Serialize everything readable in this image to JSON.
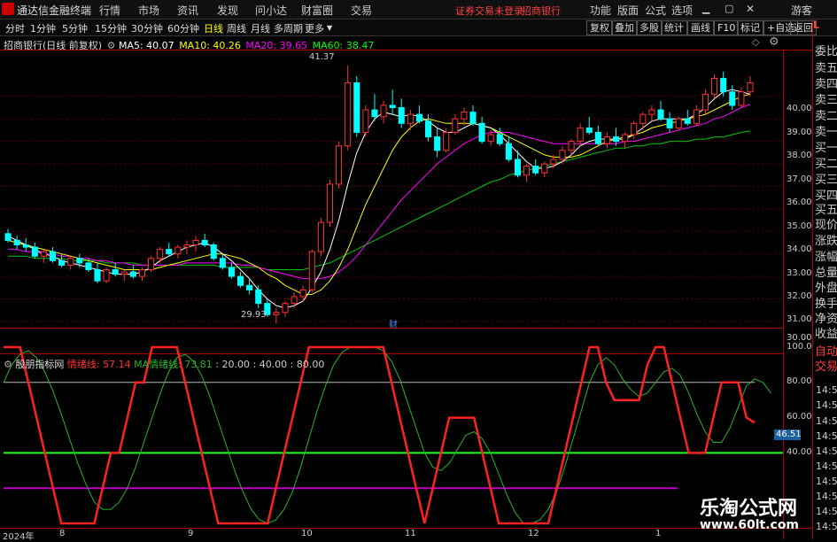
{
  "app": {
    "title": "通达信金融终端",
    "login_status": "证券交易未登录",
    "stock_short": "招商银行",
    "guest": "游客"
  },
  "menu": [
    "行情",
    "市场",
    "资讯",
    "发现",
    "问小达",
    "财富圈",
    "交易"
  ],
  "menu_right": [
    "功能",
    "版面",
    "公式",
    "选项"
  ],
  "periods": [
    "分时",
    "1分钟",
    "5分钟",
    "15分钟",
    "30分钟",
    "60分钟",
    "日线",
    "周线",
    "月线",
    "多周期",
    "更多"
  ],
  "active_period": "日线",
  "toolbar_right": [
    "复权",
    "叠加",
    "多股",
    "统计",
    "画线",
    "F10",
    "标记",
    "+自选",
    "返回"
  ],
  "chart_title": "招商银行(日线 前复权)",
  "ma": [
    {
      "label": "MA5: 40.07",
      "color": "#ffffff"
    },
    {
      "label": "MA10: 40.26",
      "color": "#ffff00"
    },
    {
      "label": "MA20: 39.65",
      "color": "#ff00ff"
    },
    {
      "label": "MA60: 38.47",
      "color": "#00ff00"
    }
  ],
  "max_label": "41.37",
  "min_label": "29.93",
  "cai_label": "财",
  "price_ticks": [
    "40.00",
    "39.00",
    "38.00",
    "37.00",
    "36.00",
    "35.00",
    "34.00",
    "33.00",
    "32.00",
    "31.00",
    "30.00"
  ],
  "right_panel": [
    "委比",
    "卖五",
    "卖四",
    "卖三",
    "卖二",
    "卖一",
    "买一",
    "买二",
    "买三",
    "买四",
    "买五",
    "现价",
    "涨跌",
    "涨幅",
    "总量",
    "外盘",
    "换手",
    "净资",
    "收益"
  ],
  "right_panel_small": "L",
  "indicator": {
    "name": "殷朋指标网",
    "line1": "情绪线: 57.14",
    "line2": "MA情绪线: 73.81",
    "levels": ": 20.00 : 40.00 : 80.00",
    "ticks": [
      "100.0",
      "80.00",
      "60.00",
      "40.00"
    ],
    "current": "46.51",
    "right_labels": [
      "自动",
      "交易"
    ],
    "time_ticks": [
      "14:56",
      "14:56",
      "14:56",
      "14:56",
      "14:56",
      "14:56",
      "14:56",
      "14:56",
      "14:56",
      "14:56"
    ]
  },
  "dates": [
    "2024年",
    "8",
    "9",
    "10",
    "11",
    "12",
    "1"
  ],
  "watermark": {
    "line1": "乐淘公式网",
    "line2": "www.60lt.com"
  },
  "chart_data": {
    "type": "candlestick",
    "ylim": [
      29.8,
      42.0
    ],
    "candles": [
      [
        33.9,
        34.1,
        33.5,
        33.6
      ],
      [
        33.6,
        33.8,
        33.2,
        33.4
      ],
      [
        33.4,
        33.7,
        33.1,
        33.3
      ],
      [
        33.3,
        33.5,
        32.8,
        32.9
      ],
      [
        32.9,
        33.2,
        32.6,
        33.1
      ],
      [
        33.1,
        33.3,
        32.6,
        32.7
      ],
      [
        32.7,
        33.0,
        32.4,
        32.5
      ],
      [
        32.5,
        32.9,
        32.3,
        32.8
      ],
      [
        32.8,
        33.0,
        32.4,
        32.6
      ],
      [
        32.6,
        32.8,
        32.2,
        32.3
      ],
      [
        32.3,
        32.6,
        31.7,
        31.8
      ],
      [
        31.8,
        32.4,
        31.7,
        32.3
      ],
      [
        32.3,
        32.6,
        32.0,
        32.1
      ],
      [
        32.1,
        32.3,
        31.8,
        32.2
      ],
      [
        32.2,
        32.5,
        31.9,
        32.0
      ],
      [
        32.0,
        32.4,
        31.8,
        32.3
      ],
      [
        32.3,
        32.9,
        32.2,
        32.8
      ],
      [
        32.8,
        33.3,
        32.6,
        33.2
      ],
      [
        33.2,
        33.5,
        32.9,
        33.0
      ],
      [
        33.0,
        33.4,
        32.8,
        33.3
      ],
      [
        33.3,
        33.6,
        33.0,
        33.4
      ],
      [
        33.4,
        33.8,
        33.1,
        33.6
      ],
      [
        33.6,
        33.9,
        33.3,
        33.4
      ],
      [
        33.4,
        33.5,
        32.7,
        32.8
      ],
      [
        32.8,
        33.0,
        32.3,
        32.4
      ],
      [
        32.4,
        32.6,
        31.9,
        32.0
      ],
      [
        32.0,
        32.2,
        31.5,
        31.6
      ],
      [
        31.6,
        31.9,
        31.2,
        31.4
      ],
      [
        31.4,
        31.6,
        30.6,
        30.8
      ],
      [
        30.8,
        31.0,
        30.2,
        30.3
      ],
      [
        30.3,
        30.6,
        29.9,
        30.4
      ],
      [
        30.4,
        30.9,
        30.2,
        30.8
      ],
      [
        30.8,
        31.3,
        30.6,
        31.1
      ],
      [
        31.1,
        31.6,
        30.9,
        31.4
      ],
      [
        31.4,
        33.2,
        31.3,
        33.1
      ],
      [
        33.1,
        34.6,
        32.9,
        34.4
      ],
      [
        34.4,
        36.3,
        34.2,
        36.1
      ],
      [
        36.1,
        38.0,
        35.9,
        37.8
      ],
      [
        37.8,
        41.37,
        37.6,
        40.6
      ],
      [
        40.6,
        40.9,
        38.2,
        38.4
      ],
      [
        38.4,
        39.6,
        38.2,
        39.4
      ],
      [
        39.4,
        40.1,
        38.9,
        39.1
      ],
      [
        39.1,
        39.8,
        38.8,
        39.6
      ],
      [
        39.6,
        40.3,
        39.2,
        39.5
      ],
      [
        39.5,
        39.9,
        38.6,
        38.8
      ],
      [
        38.8,
        39.4,
        38.5,
        39.2
      ],
      [
        39.2,
        39.6,
        38.8,
        38.9
      ],
      [
        38.9,
        39.2,
        38.0,
        38.2
      ],
      [
        38.2,
        38.6,
        37.3,
        37.6
      ],
      [
        37.6,
        38.6,
        37.5,
        38.4
      ],
      [
        38.4,
        39.2,
        38.3,
        39.0
      ],
      [
        39.0,
        39.5,
        38.7,
        39.3
      ],
      [
        39.3,
        39.6,
        38.7,
        38.8
      ],
      [
        38.8,
        39.1,
        37.9,
        38.0
      ],
      [
        38.0,
        38.5,
        37.8,
        38.3
      ],
      [
        38.3,
        38.6,
        37.8,
        37.9
      ],
      [
        37.9,
        38.2,
        37.1,
        37.2
      ],
      [
        37.2,
        37.6,
        36.4,
        36.5
      ],
      [
        36.5,
        37.0,
        36.2,
        36.9
      ],
      [
        36.9,
        37.2,
        36.5,
        36.6
      ],
      [
        36.6,
        37.1,
        36.4,
        37.0
      ],
      [
        37.0,
        37.4,
        36.8,
        37.2
      ],
      [
        37.2,
        37.8,
        37.0,
        37.6
      ],
      [
        37.6,
        38.1,
        37.4,
        38.0
      ],
      [
        38.0,
        38.8,
        37.8,
        38.6
      ],
      [
        38.6,
        39.1,
        38.3,
        38.4
      ],
      [
        38.4,
        38.7,
        37.8,
        37.9
      ],
      [
        37.9,
        38.4,
        37.7,
        38.2
      ],
      [
        38.2,
        38.6,
        37.8,
        38.0
      ],
      [
        38.0,
        38.4,
        37.7,
        38.3
      ],
      [
        38.3,
        38.9,
        38.1,
        38.8
      ],
      [
        38.8,
        39.3,
        38.5,
        39.2
      ],
      [
        39.2,
        39.6,
        38.9,
        39.4
      ],
      [
        39.4,
        39.8,
        38.9,
        39.0
      ],
      [
        39.0,
        39.3,
        38.4,
        38.6
      ],
      [
        38.6,
        39.1,
        38.5,
        39.0
      ],
      [
        39.0,
        39.4,
        38.7,
        38.8
      ],
      [
        38.8,
        39.6,
        38.7,
        39.4
      ],
      [
        39.4,
        40.3,
        39.2,
        40.1
      ],
      [
        40.1,
        41.0,
        39.9,
        40.8
      ],
      [
        40.8,
        41.1,
        40.0,
        40.2
      ],
      [
        40.2,
        40.5,
        39.4,
        39.6
      ],
      [
        39.6,
        40.4,
        39.5,
        40.2
      ],
      [
        40.2,
        40.9,
        40.0,
        40.6
      ]
    ],
    "ma5": [
      33.8,
      33.6,
      33.4,
      33.2,
      33.0,
      32.9,
      32.7,
      32.6,
      32.5,
      32.4,
      32.3,
      32.2,
      32.1,
      32.1,
      32.1,
      32.2,
      32.4,
      32.7,
      32.9,
      33.1,
      33.3,
      33.4,
      33.5,
      33.3,
      33.0,
      32.7,
      32.3,
      31.9,
      31.4,
      31.0,
      30.7,
      30.6,
      30.7,
      30.9,
      31.5,
      32.2,
      33.2,
      34.5,
      36.1,
      37.5,
      38.4,
      39.0,
      39.3,
      39.2,
      39.1,
      39.2,
      39.1,
      38.9,
      38.6,
      38.4,
      38.4,
      38.6,
      38.8,
      38.7,
      38.6,
      38.3,
      37.9,
      37.5,
      37.1,
      36.8,
      36.8,
      36.9,
      37.1,
      37.4,
      37.8,
      38.0,
      38.1,
      38.1,
      38.1,
      38.1,
      38.3,
      38.6,
      38.9,
      39.0,
      39.0,
      39.0,
      39.0,
      39.2,
      39.5,
      39.9,
      40.2,
      40.3,
      40.2,
      40.1
    ],
    "ma10": [
      33.6,
      33.5,
      33.4,
      33.3,
      33.2,
      33.1,
      33.0,
      32.9,
      32.8,
      32.7,
      32.6,
      32.5,
      32.4,
      32.3,
      32.3,
      32.3,
      32.3,
      32.4,
      32.5,
      32.6,
      32.7,
      32.8,
      32.9,
      33.0,
      33.0,
      32.9,
      32.8,
      32.6,
      32.4,
      32.1,
      31.9,
      31.6,
      31.4,
      31.2,
      31.2,
      31.4,
      31.8,
      32.4,
      33.2,
      34.2,
      35.2,
      36.0,
      36.8,
      37.6,
      38.2,
      38.6,
      38.9,
      39.0,
      38.9,
      38.8,
      38.8,
      38.8,
      38.8,
      38.7,
      38.6,
      38.4,
      38.2,
      38.0,
      37.8,
      37.6,
      37.4,
      37.3,
      37.3,
      37.3,
      37.4,
      37.6,
      37.8,
      38.0,
      38.1,
      38.2,
      38.3,
      38.4,
      38.6,
      38.7,
      38.8,
      38.9,
      39.0,
      39.1,
      39.2,
      39.4,
      39.6,
      39.8,
      40.0,
      40.1
    ],
    "ma20": [
      33.2,
      33.2,
      33.1,
      33.1,
      33.0,
      33.0,
      32.9,
      32.9,
      32.8,
      32.8,
      32.7,
      32.7,
      32.6,
      32.6,
      32.5,
      32.5,
      32.5,
      32.5,
      32.5,
      32.5,
      32.6,
      32.6,
      32.6,
      32.6,
      32.6,
      32.6,
      32.5,
      32.5,
      32.4,
      32.3,
      32.2,
      32.1,
      32.0,
      31.9,
      31.9,
      31.9,
      32.0,
      32.2,
      32.5,
      32.9,
      33.4,
      33.9,
      34.4,
      34.9,
      35.4,
      35.8,
      36.2,
      36.6,
      37.0,
      37.3,
      37.6,
      37.9,
      38.1,
      38.3,
      38.4,
      38.4,
      38.4,
      38.3,
      38.2,
      38.1,
      38.0,
      37.9,
      37.9,
      37.9,
      37.9,
      37.9,
      37.9,
      37.9,
      37.9,
      38.0,
      38.0,
      38.1,
      38.2,
      38.3,
      38.4,
      38.5,
      38.6,
      38.7,
      38.8,
      39.0,
      39.1,
      39.3,
      39.5,
      39.65
    ],
    "ma60": [
      32.9,
      32.9,
      32.9,
      32.8,
      32.8,
      32.8,
      32.8,
      32.7,
      32.7,
      32.7,
      32.7,
      32.6,
      32.6,
      32.6,
      32.6,
      32.5,
      32.5,
      32.5,
      32.5,
      32.5,
      32.5,
      32.5,
      32.5,
      32.5,
      32.4,
      32.4,
      32.4,
      32.4,
      32.4,
      32.3,
      32.3,
      32.3,
      32.3,
      32.3,
      32.4,
      32.5,
      32.6,
      32.8,
      33.0,
      33.2,
      33.4,
      33.6,
      33.8,
      34.0,
      34.2,
      34.4,
      34.6,
      34.8,
      35.0,
      35.2,
      35.4,
      35.6,
      35.8,
      36.0,
      36.2,
      36.3,
      36.5,
      36.6,
      36.7,
      36.8,
      36.9,
      37.0,
      37.1,
      37.2,
      37.3,
      37.4,
      37.5,
      37.6,
      37.7,
      37.7,
      37.8,
      37.8,
      37.9,
      37.9,
      38.0,
      38.0,
      38.0,
      38.1,
      38.1,
      38.2,
      38.2,
      38.3,
      38.4,
      38.47
    ],
    "indicator": {
      "ylim": [
        0,
        100
      ],
      "emotion": [
        100,
        100,
        100,
        80,
        60,
        40,
        20,
        0,
        0,
        0,
        0,
        0,
        20,
        40,
        40,
        60,
        80,
        80,
        100,
        100,
        100,
        100,
        80,
        60,
        40,
        20,
        0,
        0,
        0,
        0,
        0,
        0,
        0,
        20,
        40,
        60,
        80,
        100,
        100,
        100,
        100,
        100,
        100,
        100,
        100,
        100,
        100,
        80,
        60,
        40,
        20,
        0,
        20,
        40,
        60,
        60,
        60,
        60,
        40,
        20,
        0,
        0,
        0,
        0,
        0,
        0,
        0,
        20,
        40,
        60,
        80,
        100,
        100,
        80,
        70,
        70,
        70,
        70,
        90,
        100,
        100,
        80,
        60,
        40,
        40,
        40,
        60,
        80,
        80,
        80,
        60,
        57.14
      ],
      "ma_emotion": [
        80,
        90,
        96,
        98,
        94,
        86,
        75,
        62,
        48,
        34,
        22,
        12,
        8,
        8,
        12,
        20,
        32,
        46,
        60,
        74,
        86,
        94,
        96,
        92,
        84,
        72,
        58,
        44,
        30,
        18,
        8,
        2,
        0,
        2,
        8,
        18,
        32,
        48,
        64,
        78,
        90,
        97,
        100,
        100,
        100,
        100,
        98,
        92,
        82,
        68,
        54,
        40,
        32,
        30,
        34,
        42,
        50,
        52,
        48,
        40,
        28,
        16,
        6,
        0,
        0,
        2,
        8,
        18,
        32,
        48,
        64,
        80,
        90,
        94,
        90,
        82,
        76,
        72,
        74,
        80,
        86,
        88,
        84,
        74,
        62,
        52,
        46,
        46,
        54,
        66,
        78,
        82,
        80,
        73.81
      ],
      "levels": [
        20,
        40,
        80
      ]
    }
  }
}
